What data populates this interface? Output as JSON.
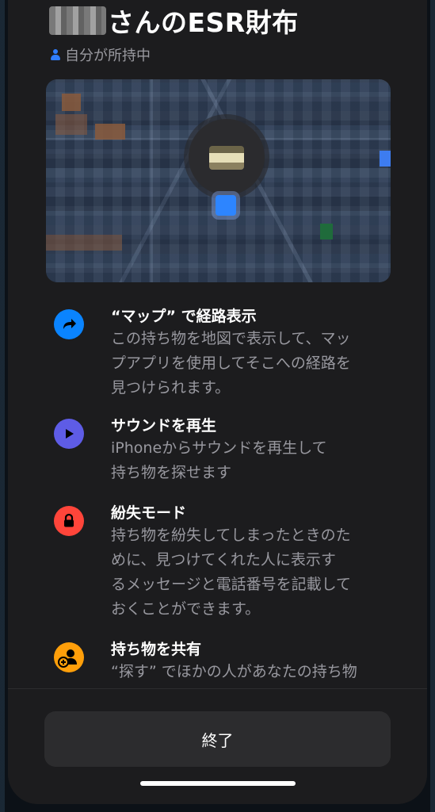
{
  "header": {
    "title": "さんのESR財布",
    "subtitle": "自分が所持中"
  },
  "colors": {
    "directions": "#0a84ff",
    "sound": "#5e5ce6",
    "lost": "#ff453a",
    "share": "#ff9f0a"
  },
  "features": [
    {
      "icon": "directions-icon",
      "heading": "“マップ” で経路表示",
      "description": "この持ち物を地図で表示して、マッ\nプアプリを使用してそこへの経路を\n見つけられます。"
    },
    {
      "icon": "play-sound-icon",
      "heading": "サウンドを再生",
      "description": "iPhoneからサウンドを再生して\n持ち物を探せます"
    },
    {
      "icon": "lock-icon",
      "heading": "紛失モード",
      "description": "持ち物を紛失してしまったときのた\nめに、見つけてくれた人に表示す\nるメッセージと電話番号を記載して\nおくことができます。"
    },
    {
      "icon": "share-person-add-icon",
      "heading": "持ち物を共有",
      "description": "“探す” でほかの人があなたの持ち物\nを見つけられるようにします"
    }
  ],
  "footer": {
    "done_label": "終了"
  }
}
